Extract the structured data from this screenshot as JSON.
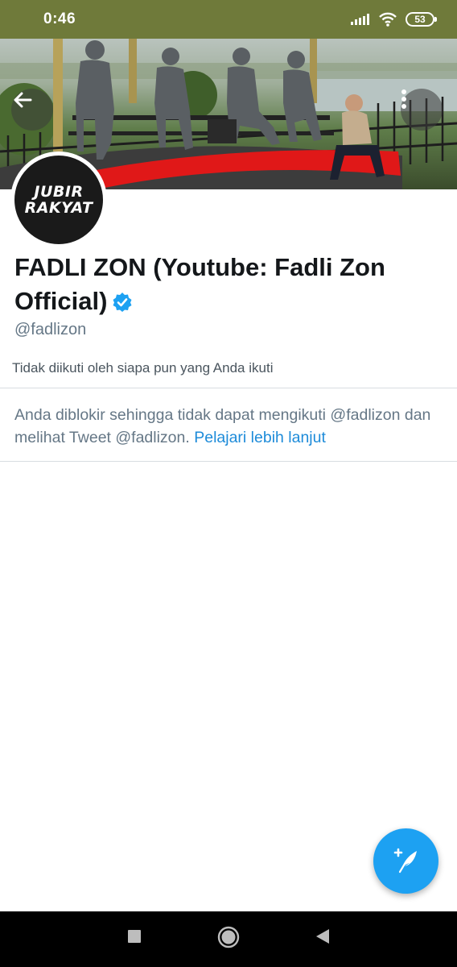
{
  "status_bar": {
    "time": "0:46",
    "battery": "53",
    "icons": [
      "signal-icon",
      "wifi-icon",
      "battery-icon"
    ]
  },
  "banner": {
    "back_icon": "arrow-left-icon",
    "more_icon": "more-vertical-icon"
  },
  "avatar": {
    "line1": "JUBIR",
    "line2": "RAKYAT"
  },
  "profile": {
    "name": "FADLI ZON (Youtube: Fadli Zon Official)",
    "handle": "@fadlizon",
    "verified_icon": "verified-badge-icon",
    "followed_by": "Tidak diikuti oleh siapa pun yang Anda ikuti"
  },
  "blocked": {
    "message": "Anda diblokir sehingga tidak dapat mengikuti @fadlizon dan melihat Tweet @fadlizon.",
    "link": "Pelajari lebih lanjut"
  },
  "fab": {
    "icon": "compose-tweet-icon"
  },
  "nav": {
    "icons": [
      "recent-apps-icon",
      "home-icon",
      "back-icon"
    ]
  },
  "colors": {
    "accent": "#1da1f2",
    "link": "#1d8bd9",
    "status_bar": "#6f7a3a",
    "secondary_text": "#657786"
  }
}
